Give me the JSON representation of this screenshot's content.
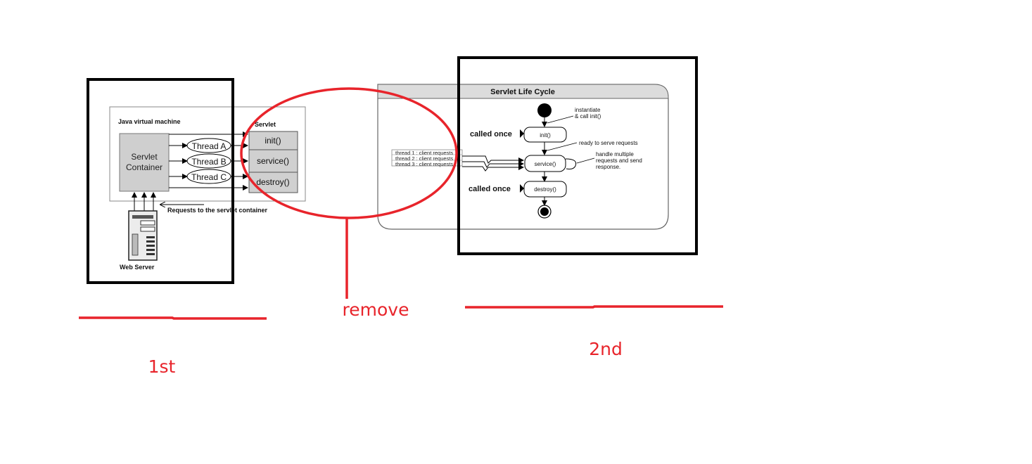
{
  "diagram1": {
    "jvm_label": "Java virtual machine",
    "container_line1": "Servlet",
    "container_line2": "Container",
    "threads": [
      "Thread A",
      "Thread B",
      "Thread C"
    ],
    "servlet_label": "Servlet",
    "methods": [
      "init()",
      "service()",
      "destroy()"
    ],
    "requests_label": "Requests to the servlet container",
    "web_server_label": "Web Server"
  },
  "diagram2": {
    "title": "Servlet Life Cycle",
    "instantiate_line1": "instantiate",
    "instantiate_line2": "& call  init()",
    "called_once_top": "called once",
    "init_state": "init()",
    "ready_note": "ready to serve requests",
    "client_requests": [
      "thread 1 : client requests",
      "thread 2 : client requests",
      "thread 3 : client requests"
    ],
    "service_state": "service()",
    "handle_line1": "handle multiple",
    "handle_line2": "requests and send",
    "handle_line3": "response.",
    "called_once_bottom": "called once",
    "destroy_state": "destroy()"
  },
  "annotations": {
    "first": "1st",
    "second": "2nd",
    "remove": "remove",
    "colors": {
      "red": "#e8242b",
      "black": "#000000"
    }
  }
}
